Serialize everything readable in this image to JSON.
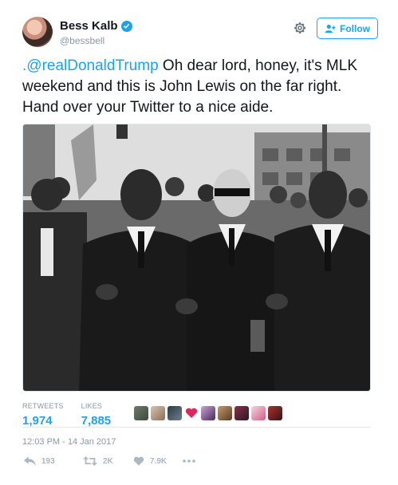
{
  "author": {
    "name": "Bess Kalb",
    "handle": "@bessbell",
    "verified": true
  },
  "follow": {
    "label": "Follow"
  },
  "tweet": {
    "mention": ".@realDonaldTrump",
    "text": " Oh dear lord, honey, it's MLK weekend and this is John Lewis on the far right. Hand over your Twitter to a nice aide."
  },
  "stats": {
    "retweets_label": "RETWEETS",
    "retweets_value": "1,974",
    "likes_label": "LIKES",
    "likes_value": "7,885"
  },
  "timestamp": "12:03 PM - 14 Jan 2017",
  "actions": {
    "reply_count": "193",
    "retweet_count": "2K",
    "like_count": "7.9K"
  },
  "colors": {
    "accent": "#1da1f2",
    "muted": "#8899a6"
  },
  "icons": [
    "verified-badge-icon",
    "gear-icon",
    "follow-person-icon",
    "reply-icon",
    "retweet-icon",
    "heart-icon",
    "more-icon"
  ]
}
